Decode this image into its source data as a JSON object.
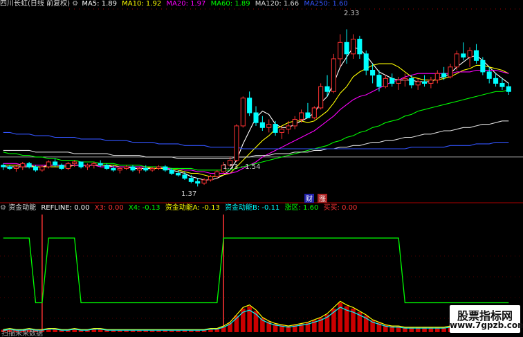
{
  "top_legend": {
    "title": "四川长虹(日线 前复权)",
    "items": [
      {
        "label": "MA5: 1.89",
        "color": "#ffffff"
      },
      {
        "label": "MA10: 1.92",
        "color": "#ffff00"
      },
      {
        "label": "MA20: 1.97",
        "color": "#ff00ff"
      },
      {
        "label": "MA60: 1.89",
        "color": "#00ff00"
      },
      {
        "label": "MA120: 1.66",
        "color": "#dddddd"
      },
      {
        "label": "MA250: 1.60",
        "color": "#3355ff"
      }
    ]
  },
  "bottom_legend": {
    "title": "资金动能",
    "items": [
      {
        "label": "REFLINE: 0.00",
        "color": "#ffffff"
      },
      {
        "label": "X3: 0.00",
        "color": "#ff3333"
      },
      {
        "label": "X4: -0.13",
        "color": "#00ff00"
      },
      {
        "label": "资金动能A: -0.13",
        "color": "#ffff00"
      },
      {
        "label": "资金动能B: -0.11",
        "color": "#00ffff"
      },
      {
        "label": "涨区: 1.60",
        "color": "#00ff00"
      },
      {
        "label": "买买: 0.00",
        "color": "#ff3333"
      }
    ]
  },
  "annotations": {
    "high": "2.33",
    "low": "1.37",
    "mid": "1.53 - 1.54",
    "tag_cai": "财",
    "tag_zhang": "涨"
  },
  "bottom_left_text": "扫描未来数据",
  "watermark": {
    "line1": "股票指标网",
    "line2": "www.7gpzb.com"
  },
  "colors": {
    "up": "#ff3333",
    "down": "#00ffff",
    "background": "#000000",
    "divider": "#aa0000"
  },
  "chart_data": {
    "type": "candlestick",
    "price_range": [
      1.3,
      2.45
    ],
    "ohlc": [
      [
        1.5,
        1.51,
        1.47,
        1.49
      ],
      [
        1.49,
        1.5,
        1.47,
        1.48
      ],
      [
        1.48,
        1.5,
        1.46,
        1.49
      ],
      [
        1.49,
        1.52,
        1.47,
        1.51
      ],
      [
        1.51,
        1.52,
        1.48,
        1.49
      ],
      [
        1.49,
        1.5,
        1.46,
        1.47
      ],
      [
        1.47,
        1.5,
        1.46,
        1.49
      ],
      [
        1.49,
        1.53,
        1.48,
        1.52
      ],
      [
        1.52,
        1.54,
        1.49,
        1.5
      ],
      [
        1.5,
        1.51,
        1.47,
        1.48
      ],
      [
        1.48,
        1.52,
        1.47,
        1.51
      ],
      [
        1.51,
        1.53,
        1.49,
        1.52
      ],
      [
        1.52,
        1.52,
        1.48,
        1.49
      ],
      [
        1.49,
        1.51,
        1.47,
        1.5
      ],
      [
        1.5,
        1.52,
        1.48,
        1.51
      ],
      [
        1.51,
        1.53,
        1.49,
        1.5
      ],
      [
        1.5,
        1.51,
        1.47,
        1.48
      ],
      [
        1.48,
        1.5,
        1.46,
        1.47
      ],
      [
        1.47,
        1.49,
        1.45,
        1.48
      ],
      [
        1.48,
        1.5,
        1.47,
        1.49
      ],
      [
        1.49,
        1.5,
        1.46,
        1.47
      ],
      [
        1.47,
        1.49,
        1.45,
        1.48
      ],
      [
        1.48,
        1.5,
        1.46,
        1.47
      ],
      [
        1.47,
        1.49,
        1.46,
        1.48
      ],
      [
        1.48,
        1.5,
        1.47,
        1.49
      ],
      [
        1.49,
        1.5,
        1.46,
        1.47
      ],
      [
        1.47,
        1.48,
        1.44,
        1.45
      ],
      [
        1.45,
        1.47,
        1.43,
        1.44
      ],
      [
        1.44,
        1.46,
        1.41,
        1.42
      ],
      [
        1.42,
        1.44,
        1.39,
        1.4
      ],
      [
        1.4,
        1.42,
        1.37,
        1.39
      ],
      [
        1.39,
        1.42,
        1.38,
        1.41
      ],
      [
        1.41,
        1.44,
        1.4,
        1.43
      ],
      [
        1.43,
        1.47,
        1.42,
        1.46
      ],
      [
        1.46,
        1.52,
        1.45,
        1.5
      ],
      [
        1.5,
        1.55,
        1.49,
        1.53
      ],
      [
        1.53,
        1.75,
        1.52,
        1.74
      ],
      [
        1.74,
        1.92,
        1.73,
        1.91
      ],
      [
        1.91,
        1.95,
        1.8,
        1.82
      ],
      [
        1.82,
        1.86,
        1.74,
        1.76
      ],
      [
        1.76,
        1.8,
        1.71,
        1.73
      ],
      [
        1.73,
        1.78,
        1.7,
        1.75
      ],
      [
        1.75,
        1.77,
        1.68,
        1.7
      ],
      [
        1.7,
        1.74,
        1.66,
        1.72
      ],
      [
        1.72,
        1.77,
        1.69,
        1.74
      ],
      [
        1.74,
        1.8,
        1.72,
        1.78
      ],
      [
        1.78,
        1.84,
        1.76,
        1.82
      ],
      [
        1.82,
        1.88,
        1.8,
        1.79
      ],
      [
        1.79,
        1.86,
        1.78,
        1.85
      ],
      [
        1.85,
        2.0,
        1.84,
        1.98
      ],
      [
        1.98,
        2.05,
        1.92,
        1.95
      ],
      [
        1.95,
        2.18,
        1.94,
        2.15
      ],
      [
        2.15,
        2.3,
        2.1,
        2.25
      ],
      [
        2.25,
        2.33,
        2.12,
        2.18
      ],
      [
        2.18,
        2.3,
        2.15,
        2.27
      ],
      [
        2.27,
        2.29,
        2.15,
        2.18
      ],
      [
        2.18,
        2.2,
        2.05,
        2.08
      ],
      [
        2.08,
        2.12,
        2.0,
        2.05
      ],
      [
        2.05,
        2.08,
        1.95,
        1.98
      ],
      [
        1.98,
        2.05,
        1.97,
        2.03
      ],
      [
        2.03,
        2.06,
        1.98,
        2.0
      ],
      [
        2.0,
        2.04,
        1.96,
        2.02
      ],
      [
        2.02,
        2.06,
        1.98,
        2.03
      ],
      [
        2.03,
        2.05,
        1.97,
        1.99
      ],
      [
        1.99,
        2.03,
        1.96,
        2.01
      ],
      [
        2.01,
        2.05,
        1.98,
        2.0
      ],
      [
        2.0,
        2.04,
        1.97,
        2.02
      ],
      [
        2.02,
        2.08,
        2.0,
        2.06
      ],
      [
        2.06,
        2.1,
        2.02,
        2.04
      ],
      [
        2.04,
        2.12,
        2.03,
        2.1
      ],
      [
        2.1,
        2.2,
        2.08,
        2.18
      ],
      [
        2.18,
        2.25,
        2.14,
        2.16
      ],
      [
        2.16,
        2.22,
        2.1,
        2.2
      ],
      [
        2.2,
        2.24,
        2.12,
        2.14
      ],
      [
        2.14,
        2.16,
        2.05,
        2.07
      ],
      [
        2.07,
        2.1,
        2.0,
        2.03
      ],
      [
        2.03,
        2.06,
        1.98,
        2.0
      ],
      [
        2.0,
        2.03,
        1.96,
        1.98
      ],
      [
        1.98,
        2.0,
        1.93,
        1.95
      ]
    ],
    "ma_lines": [
      {
        "name": "MA5",
        "color": "#ffffff",
        "values": [
          1.49,
          1.49,
          1.49,
          1.49,
          1.49,
          1.49,
          1.49,
          1.5,
          1.5,
          1.5,
          1.5,
          1.5,
          1.5,
          1.5,
          1.5,
          1.5,
          1.5,
          1.49,
          1.49,
          1.49,
          1.48,
          1.48,
          1.48,
          1.48,
          1.48,
          1.48,
          1.47,
          1.46,
          1.45,
          1.43,
          1.42,
          1.41,
          1.41,
          1.42,
          1.44,
          1.47,
          1.53,
          1.63,
          1.71,
          1.79,
          1.83,
          1.81,
          1.75,
          1.73,
          1.73,
          1.75,
          1.77,
          1.79,
          1.82,
          1.88,
          1.92,
          2.0,
          2.1,
          2.16,
          2.22,
          2.21,
          2.17,
          2.12,
          2.07,
          2.05,
          2.03,
          2.02,
          2.02,
          2.02,
          2.01,
          2.01,
          2.01,
          2.03,
          2.04,
          2.06,
          2.1,
          2.13,
          2.16,
          2.17,
          2.14,
          2.1,
          2.06,
          2.03,
          2.0
        ]
      },
      {
        "name": "MA10",
        "color": "#ffff00",
        "values": [
          1.5,
          1.5,
          1.5,
          1.5,
          1.5,
          1.49,
          1.49,
          1.49,
          1.49,
          1.49,
          1.49,
          1.5,
          1.5,
          1.5,
          1.5,
          1.5,
          1.5,
          1.5,
          1.49,
          1.49,
          1.49,
          1.49,
          1.49,
          1.48,
          1.48,
          1.48,
          1.48,
          1.47,
          1.46,
          1.45,
          1.45,
          1.44,
          1.43,
          1.43,
          1.44,
          1.45,
          1.49,
          1.53,
          1.57,
          1.61,
          1.65,
          1.68,
          1.72,
          1.74,
          1.76,
          1.77,
          1.77,
          1.76,
          1.77,
          1.8,
          1.83,
          1.88,
          1.94,
          1.98,
          2.04,
          2.07,
          2.09,
          2.11,
          2.12,
          2.12,
          2.12,
          2.1,
          2.07,
          2.04,
          2.03,
          2.02,
          2.02,
          2.02,
          2.03,
          2.04,
          2.06,
          2.08,
          2.09,
          2.11,
          2.11,
          2.1,
          2.09,
          2.08,
          2.06
        ]
      },
      {
        "name": "MA20",
        "color": "#ff00ff",
        "values": [
          1.51,
          1.51,
          1.51,
          1.5,
          1.5,
          1.5,
          1.5,
          1.5,
          1.5,
          1.5,
          1.5,
          1.5,
          1.5,
          1.5,
          1.5,
          1.49,
          1.49,
          1.49,
          1.49,
          1.49,
          1.49,
          1.49,
          1.49,
          1.49,
          1.49,
          1.48,
          1.48,
          1.48,
          1.47,
          1.47,
          1.46,
          1.46,
          1.45,
          1.45,
          1.45,
          1.45,
          1.46,
          1.48,
          1.5,
          1.52,
          1.55,
          1.57,
          1.59,
          1.61,
          1.63,
          1.65,
          1.67,
          1.69,
          1.71,
          1.74,
          1.77,
          1.8,
          1.84,
          1.87,
          1.9,
          1.92,
          1.93,
          1.95,
          1.97,
          1.99,
          2.01,
          2.02,
          2.04,
          2.05,
          2.06,
          2.06,
          2.06,
          2.06,
          2.06,
          2.06,
          2.07,
          2.07,
          2.07,
          2.08,
          2.08,
          2.08,
          2.08,
          2.07,
          2.06
        ]
      },
      {
        "name": "MA60",
        "color": "#00ff00",
        "values": [
          1.58,
          1.57,
          1.57,
          1.56,
          1.56,
          1.55,
          1.55,
          1.54,
          1.54,
          1.53,
          1.53,
          1.53,
          1.52,
          1.52,
          1.52,
          1.51,
          1.51,
          1.51,
          1.5,
          1.5,
          1.5,
          1.5,
          1.49,
          1.49,
          1.49,
          1.49,
          1.48,
          1.48,
          1.48,
          1.48,
          1.47,
          1.47,
          1.47,
          1.47,
          1.47,
          1.47,
          1.48,
          1.49,
          1.5,
          1.51,
          1.52,
          1.53,
          1.54,
          1.55,
          1.56,
          1.57,
          1.58,
          1.59,
          1.6,
          1.61,
          1.62,
          1.64,
          1.65,
          1.67,
          1.68,
          1.7,
          1.71,
          1.73,
          1.74,
          1.76,
          1.77,
          1.78,
          1.8,
          1.81,
          1.83,
          1.84,
          1.85,
          1.86,
          1.87,
          1.88,
          1.89,
          1.9,
          1.91,
          1.92,
          1.93,
          1.94,
          1.95,
          1.95,
          1.96
        ]
      },
      {
        "name": "MA120",
        "color": "#dddddd",
        "values": [
          1.59,
          1.59,
          1.59,
          1.59,
          1.59,
          1.58,
          1.58,
          1.58,
          1.58,
          1.58,
          1.58,
          1.57,
          1.57,
          1.57,
          1.57,
          1.57,
          1.57,
          1.56,
          1.56,
          1.56,
          1.56,
          1.56,
          1.55,
          1.55,
          1.55,
          1.55,
          1.55,
          1.54,
          1.54,
          1.54,
          1.54,
          1.54,
          1.54,
          1.54,
          1.54,
          1.54,
          1.55,
          1.55,
          1.55,
          1.56,
          1.56,
          1.56,
          1.57,
          1.57,
          1.57,
          1.58,
          1.58,
          1.58,
          1.59,
          1.59,
          1.6,
          1.6,
          1.61,
          1.61,
          1.62,
          1.62,
          1.63,
          1.64,
          1.64,
          1.65,
          1.65,
          1.66,
          1.67,
          1.67,
          1.68,
          1.69,
          1.69,
          1.7,
          1.71,
          1.71,
          1.72,
          1.73,
          1.73,
          1.74,
          1.75,
          1.75,
          1.76,
          1.77,
          1.77
        ]
      },
      {
        "name": "MA250",
        "color": "#3355ff",
        "values": [
          1.7,
          1.7,
          1.69,
          1.69,
          1.69,
          1.68,
          1.68,
          1.68,
          1.67,
          1.67,
          1.67,
          1.67,
          1.66,
          1.66,
          1.66,
          1.66,
          1.65,
          1.65,
          1.65,
          1.65,
          1.64,
          1.64,
          1.64,
          1.64,
          1.63,
          1.63,
          1.63,
          1.63,
          1.62,
          1.62,
          1.62,
          1.62,
          1.61,
          1.61,
          1.61,
          1.61,
          1.61,
          1.6,
          1.6,
          1.6,
          1.6,
          1.6,
          1.6,
          1.6,
          1.6,
          1.6,
          1.6,
          1.6,
          1.6,
          1.6,
          1.6,
          1.6,
          1.6,
          1.6,
          1.6,
          1.6,
          1.6,
          1.6,
          1.6,
          1.6,
          1.6,
          1.6,
          1.6,
          1.61,
          1.61,
          1.61,
          1.61,
          1.61,
          1.61,
          1.62,
          1.62,
          1.62,
          1.62,
          1.63,
          1.63,
          1.63,
          1.64,
          1.64,
          1.64
        ]
      }
    ],
    "reference_price": 1.55,
    "indicator": {
      "range": [
        0,
        1
      ],
      "zhangqu": [
        0.8,
        0.8,
        0.8,
        0.8,
        0.8,
        0.25,
        0.25,
        0.8,
        0.8,
        0.8,
        0.8,
        0.8,
        0.25,
        0.25,
        0.25,
        0.25,
        0.25,
        0.25,
        0.25,
        0.25,
        0.25,
        0.25,
        0.25,
        0.25,
        0.25,
        0.25,
        0.25,
        0.25,
        0.25,
        0.25,
        0.25,
        0.25,
        0.25,
        0.25,
        0.8,
        0.8,
        0.8,
        0.8,
        0.8,
        0.8,
        0.8,
        0.8,
        0.8,
        0.8,
        0.8,
        0.8,
        0.8,
        0.8,
        0.8,
        0.8,
        0.8,
        0.8,
        0.8,
        0.8,
        0.8,
        0.8,
        0.8,
        0.8,
        0.8,
        0.8,
        0.8,
        0.8,
        0.25,
        0.25,
        0.25,
        0.25,
        0.25,
        0.25,
        0.25,
        0.25,
        0.25,
        0.25,
        0.25,
        0.25,
        0.25,
        0.25,
        0.25,
        0.25,
        0.25
      ],
      "signal_bars": [
        6,
        34
      ],
      "energy": [
        0.02,
        0.03,
        0.02,
        0.02,
        0.03,
        0.02,
        0.02,
        0.03,
        0.03,
        0.02,
        0.02,
        0.03,
        0.02,
        0.02,
        0.03,
        0.03,
        0.02,
        0.02,
        0.02,
        0.02,
        0.02,
        0.02,
        0.02,
        0.02,
        0.02,
        0.02,
        0.02,
        0.02,
        0.02,
        0.02,
        0.02,
        0.02,
        0.03,
        0.03,
        0.05,
        0.08,
        0.14,
        0.2,
        0.22,
        0.18,
        0.12,
        0.09,
        0.07,
        0.06,
        0.05,
        0.06,
        0.07,
        0.08,
        0.1,
        0.12,
        0.15,
        0.2,
        0.25,
        0.22,
        0.2,
        0.17,
        0.14,
        0.1,
        0.08,
        0.06,
        0.05,
        0.05,
        0.04,
        0.04,
        0.04,
        0.04,
        0.04,
        0.04,
        0.04,
        0.05,
        0.05,
        0.06,
        0.06,
        0.06,
        0.05,
        0.05,
        0.04,
        0.04,
        0.04
      ]
    }
  }
}
